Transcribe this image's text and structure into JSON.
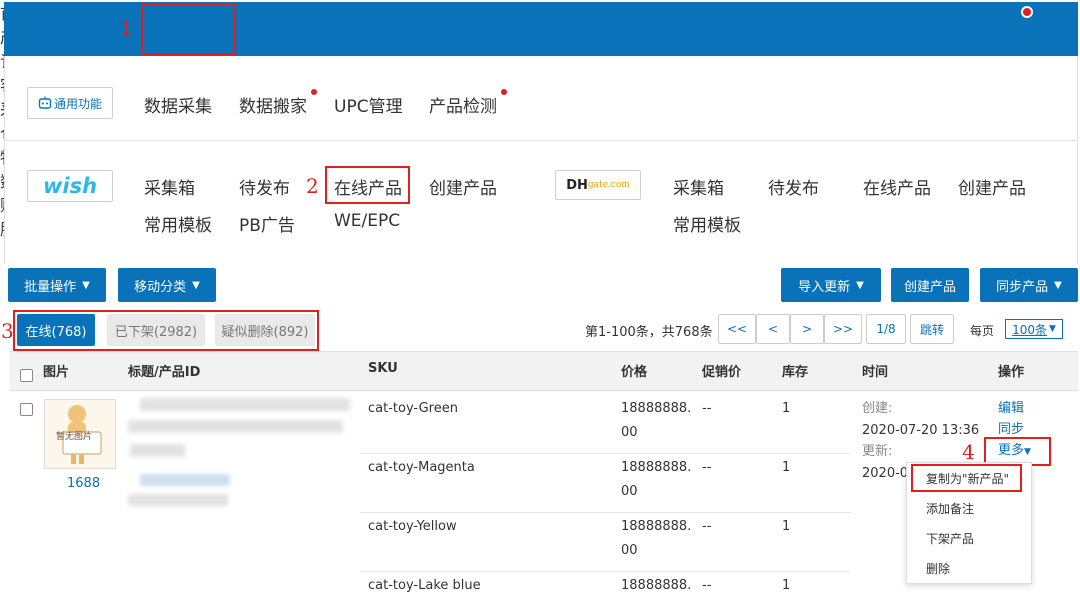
{
  "topnav": {
    "items": [
      "首页",
      "产品",
      "订单",
      "客服",
      "采购",
      "仓库",
      "物流",
      "数据",
      "财务",
      "服务"
    ],
    "active_index": 1
  },
  "annotations": [
    "1",
    "2",
    "3",
    "4"
  ],
  "menu": {
    "general": {
      "badge": "通用功能",
      "links": [
        "数据采集",
        "数据搬家",
        "UPC管理",
        "产品检测"
      ]
    },
    "wish": {
      "logo": "wish",
      "row1": [
        "采集箱",
        "待发布",
        "在线产品",
        "创建产品"
      ],
      "row2": [
        "常用模板",
        "PB广告",
        "WE/EPC"
      ]
    },
    "dhgate": {
      "logo_dh": "DH",
      "logo_rest": "gate.com",
      "row1": [
        "采集箱",
        "待发布",
        "在线产品",
        "创建产品"
      ],
      "row2": [
        "常用模板"
      ]
    }
  },
  "toolbar": {
    "batch_label": "批量操作",
    "move_label": "移动分类",
    "import_label": "导入更新",
    "create_label": "创建产品",
    "sync_label": "同步产品"
  },
  "tabs": [
    "在线(768)",
    "已下架(2982)",
    "疑似删除(892)"
  ],
  "pager": {
    "summary": "第1-100条，共768条",
    "first": "<<",
    "prev": "<",
    "next": ">",
    "last": ">>",
    "page": "1/8",
    "jump": "跳转",
    "per_page_label": "每页",
    "per_page_value": "100条"
  },
  "table": {
    "headers": [
      "图片",
      "标题/产品ID",
      "SKU",
      "价格",
      "促销价",
      "库存",
      "时间",
      "操作"
    ],
    "thumb_text": "暂无图片",
    "source": "1688",
    "rows": [
      {
        "sku": "cat-toy-Green",
        "price_1": "18888888.",
        "price_2": "00",
        "promo": "--",
        "stock": "1"
      },
      {
        "sku": "cat-toy-Magenta",
        "price_1": "18888888.",
        "price_2": "00",
        "promo": "--",
        "stock": "1"
      },
      {
        "sku": "cat-toy-Yellow",
        "price_1": "18888888.",
        "price_2": "00",
        "promo": "--",
        "stock": "1"
      },
      {
        "sku": "cat-toy-Lake blue",
        "price_1": "18888888.",
        "price_2": "",
        "promo": "--",
        "stock": "1"
      }
    ],
    "time": {
      "created_label": "创建:",
      "created_value": "2020-07-20 13:36",
      "updated_label": "更新:",
      "updated_value": "2020-07"
    },
    "actions": {
      "edit": "编辑",
      "sync": "同步",
      "more": "更多"
    }
  },
  "more_menu": [
    "复制为\"新产品\"",
    "添加备注",
    "下架产品",
    "删除"
  ],
  "colors": {
    "primary": "#0a72b8",
    "highlight": "#e02020"
  }
}
